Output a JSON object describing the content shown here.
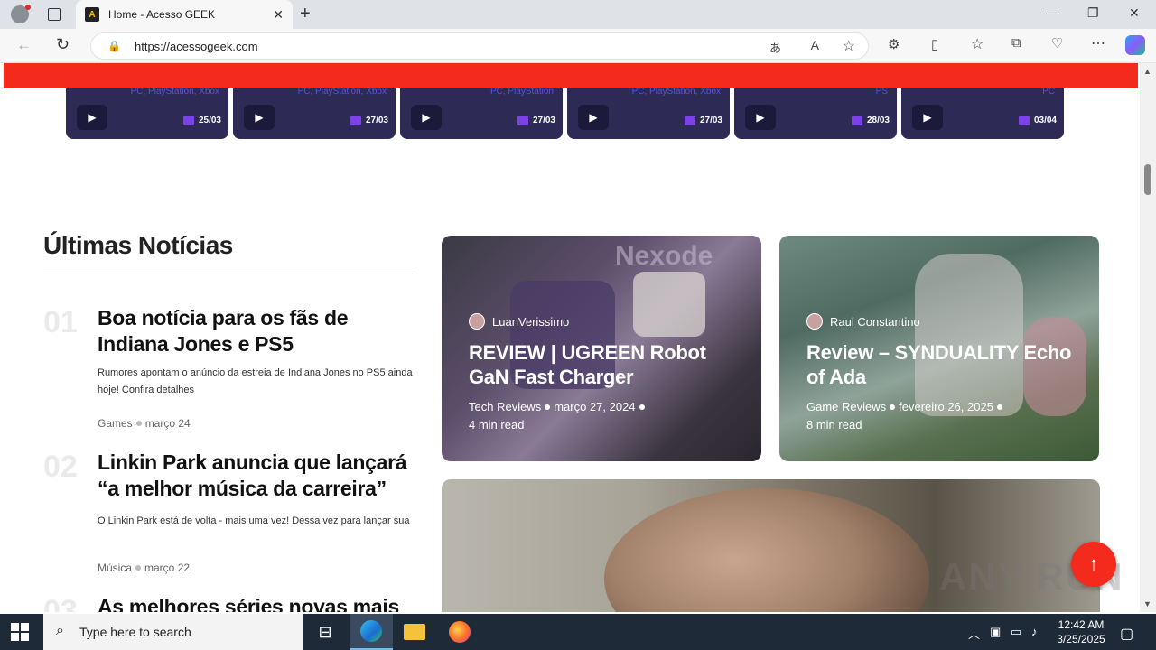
{
  "browser": {
    "tab_title": "Home - Acesso GEEK",
    "url": "https://acessogeek.com",
    "favicon_text": "A"
  },
  "game_cards": [
    {
      "platform": "PC, PlayStation, Xbox",
      "date": "25/03"
    },
    {
      "platform": "PC, PlayStation, Xbox",
      "date": "27/03"
    },
    {
      "platform": "PC, PlayStation",
      "date": "27/03"
    },
    {
      "platform": "PC, PlayStation, Xbox",
      "date": "27/03"
    },
    {
      "platform": "PS",
      "date": "28/03"
    },
    {
      "platform": "PC",
      "date": "03/04"
    }
  ],
  "latest": {
    "title": "Últimas Notícias",
    "items": [
      {
        "num": "01",
        "title": "Boa notícia para os fãs de Indiana Jones e PS5",
        "desc": "Rumores apontam o anúncio da estreia de Indiana Jones no PS5 ainda hoje! Confira detalhes",
        "category": "Games",
        "date": "março 24"
      },
      {
        "num": "02",
        "title": "Linkin Park anuncia que lançará “a melhor música da carreira”",
        "desc": "O Linkin Park está de volta - mais uma vez! Dessa vez para lançar sua",
        "category": "Música",
        "date": "março 22"
      },
      {
        "num": "03",
        "title": "As melhores séries novas mais"
      }
    ]
  },
  "features": [
    {
      "author": "LuanVerissimo",
      "title": "REVIEW | UGREEN Robot GaN Fast Charger",
      "category": "Tech Reviews",
      "date": "março 27, 2024",
      "read": "4 min read"
    },
    {
      "author": "Raul Constantino",
      "title": "Review – SYNDUALITY Echo of Ada",
      "category": "Game Reviews",
      "date": "fevereiro 26, 2025",
      "read": "8 min read"
    }
  ],
  "image_overlay_text": "Nexode",
  "watermark": "ANY RUN",
  "taskbar": {
    "search_placeholder": "Type here to search",
    "time": "12:42 AM",
    "date": "3/25/2025"
  }
}
